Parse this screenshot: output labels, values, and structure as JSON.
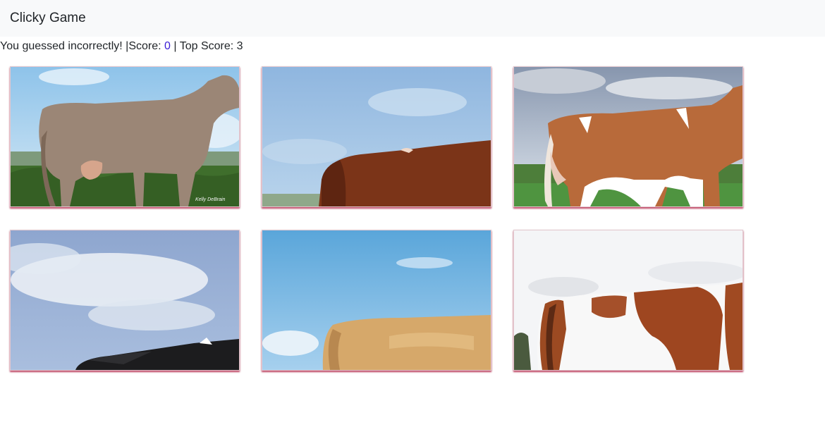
{
  "navbar": {
    "brand": "Clicky Game"
  },
  "status": {
    "message": "You guessed incorrectly! |Score: ",
    "score": "0",
    "separator": " | Top Score: ",
    "top_score": "3"
  },
  "cards": [
    {
      "subject": "brown-jersey-cow",
      "watermark": "Kelly DeBrain"
    },
    {
      "subject": "brown-cow-back"
    },
    {
      "subject": "red-white-cow"
    },
    {
      "subject": "black-cow-back"
    },
    {
      "subject": "tan-cow-back"
    },
    {
      "subject": "red-white-spotted-cow"
    }
  ]
}
